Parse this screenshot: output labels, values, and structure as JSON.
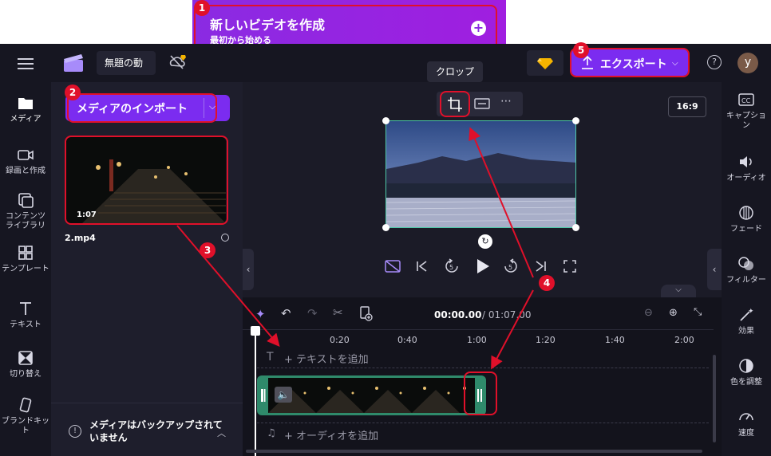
{
  "banner": {
    "title": "新しいビデオを作成",
    "subtitle": "最初から始める",
    "plus": "+"
  },
  "header": {
    "project_name": "無題の動",
    "export_label": "エクスポート",
    "avatar": "y",
    "help": "?"
  },
  "left_rail": [
    {
      "label": "メディア",
      "icon": "folder-icon"
    },
    {
      "label": "録画と作成",
      "icon": "camera-icon"
    },
    {
      "label": "コンテンツ\nライブラリ",
      "icon": "library-icon"
    },
    {
      "label": "テンプレート",
      "icon": "template-icon"
    },
    {
      "label": "テキスト",
      "icon": "text-icon"
    },
    {
      "label": "切り替え",
      "icon": "transition-icon"
    },
    {
      "label": "ブランドキット",
      "icon": "brand-icon"
    }
  ],
  "media": {
    "import_label": "メディアのインポート",
    "thumb_duration": "1:07",
    "file_name": "2.mp4",
    "backup_notice": "メディアはバックアップされていません"
  },
  "preview": {
    "tooltip": "クロップ",
    "aspect": "16:9"
  },
  "timeline": {
    "current_time": "00:00.00",
    "total_time": "/ 01:07.00",
    "ticks": [
      "0:20",
      "0:40",
      "1:00",
      "1:20",
      "1:40",
      "2:00"
    ],
    "text_track": "+ テキストを追加",
    "audio_track": "+ オーディオを追加"
  },
  "right_rail": [
    {
      "label": "キャプショ\nン",
      "icon": "captions-icon"
    },
    {
      "label": "オーディオ",
      "icon": "audio-icon"
    },
    {
      "label": "フェード",
      "icon": "fade-icon"
    },
    {
      "label": "フィルター",
      "icon": "filter-icon"
    },
    {
      "label": "効果",
      "icon": "effects-icon"
    },
    {
      "label": "色を調整",
      "icon": "color-icon"
    },
    {
      "label": "速度",
      "icon": "speed-icon"
    }
  ],
  "annotations": [
    "1",
    "2",
    "3",
    "4",
    "5"
  ],
  "colors": {
    "accent": "#7b2cf0",
    "annotation": "#e0102a",
    "clip": "#2f8a6b",
    "bg": "#161621"
  }
}
